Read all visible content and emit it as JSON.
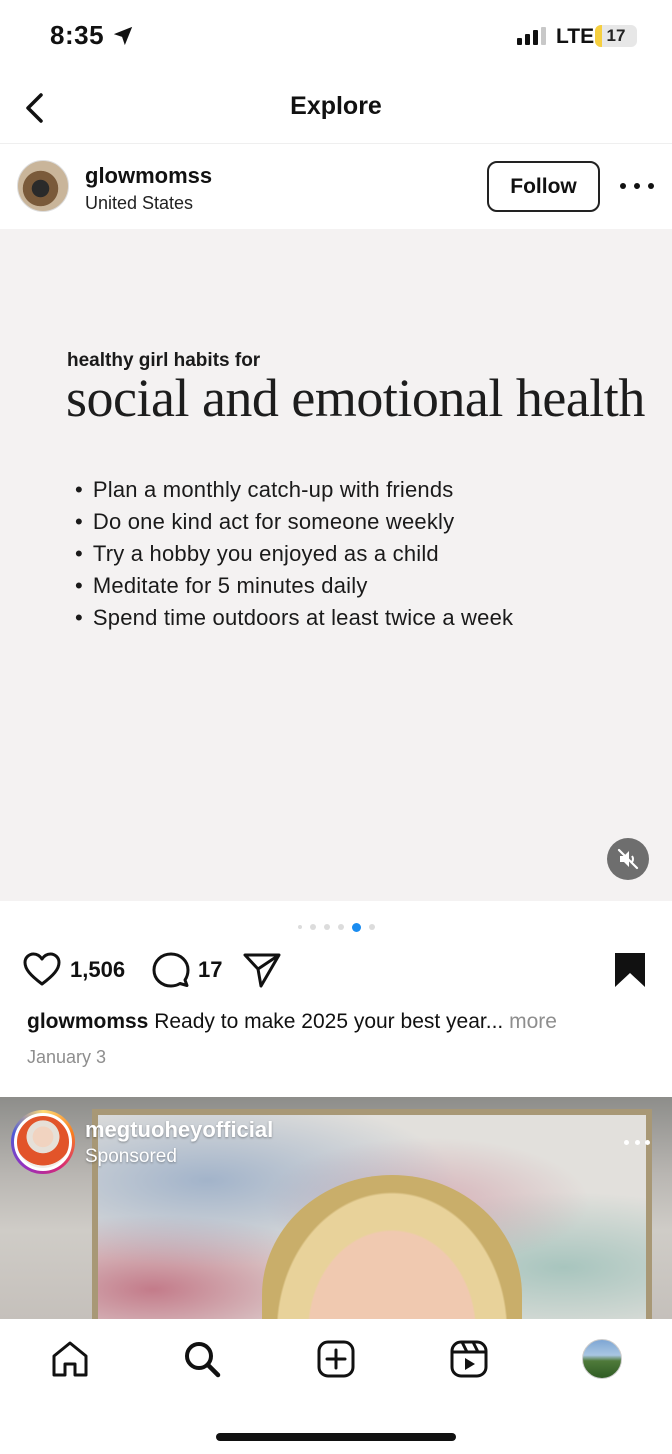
{
  "status_bar": {
    "time": "8:35",
    "network": "LTE",
    "battery": "17",
    "battery_color": "#f6cf3f"
  },
  "header": {
    "title": "Explore"
  },
  "post": {
    "username": "glowmomss",
    "location": "United States",
    "follow_label": "Follow",
    "media": {
      "kicker": "healthy girl habits for",
      "title": "social and emotional health",
      "items": [
        "Plan a monthly catch-up with friends",
        "Do one kind act for someone weekly",
        "Try a hobby you enjoyed as a child",
        "Meditate for 5 minutes daily",
        "Spend time outdoors at least twice a week"
      ]
    },
    "carousel": {
      "total_slides": 6,
      "active_slide": 5,
      "active_color": "#1a8cf0"
    },
    "likes": "1,506",
    "comments": "17",
    "caption_user": "glowmomss",
    "caption_text": "Ready to make 2025 your best year...",
    "caption_more": "more",
    "date": "January 3"
  },
  "post2": {
    "username": "megtuoheyofficial",
    "label": "Sponsored"
  },
  "icons": {
    "back": "chevron-left-icon",
    "more": "more-horizontal-icon",
    "mute": "speaker-muted-icon",
    "like": "heart-icon",
    "comment": "comment-icon",
    "share": "paper-plane-icon",
    "save": "bookmark-icon",
    "home": "home-icon",
    "search": "search-icon",
    "create": "plus-square-icon",
    "reels": "reels-icon"
  }
}
